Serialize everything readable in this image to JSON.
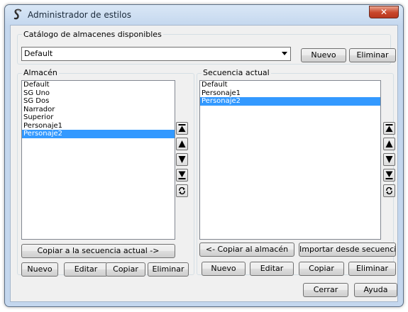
{
  "window": {
    "title": "Administrador de estilos",
    "close_glyph": "✕"
  },
  "catalog": {
    "label": "Catálogo de almacenes disponibles",
    "selected": "Default",
    "new_label": "Nuevo",
    "delete_label": "Eliminar"
  },
  "store": {
    "label": "Almacén",
    "items": [
      "Default",
      "SG Uno",
      "SG Dos",
      "Narrador",
      "Superior",
      "Personaje1",
      "Personaje2"
    ],
    "selected_index": 6,
    "copy_to_sequence_label": "Copiar a la secuencia actual ->",
    "new_label": "Nuevo",
    "edit_label": "Editar",
    "copy_label": "Copiar",
    "delete_label": "Eliminar"
  },
  "sequence": {
    "label": "Secuencia actual",
    "items": [
      "Default",
      "Personaje1",
      "Personaje2"
    ],
    "selected_index": 2,
    "copy_to_store_label": "<- Copiar al almacén",
    "import_label": "Importar desde secuencia...",
    "new_label": "Nuevo",
    "edit_label": "Editar",
    "copy_label": "Copiar",
    "delete_label": "Eliminar"
  },
  "footer": {
    "close_label": "Cerrar",
    "help_label": "Ayuda"
  },
  "icons": [
    "style-s-icon",
    "move-top-icon",
    "move-up-icon",
    "move-down-icon",
    "move-bottom-icon",
    "refresh-icon"
  ],
  "colors": {
    "selection": "#3399ff",
    "close_button": "#c8452a"
  }
}
